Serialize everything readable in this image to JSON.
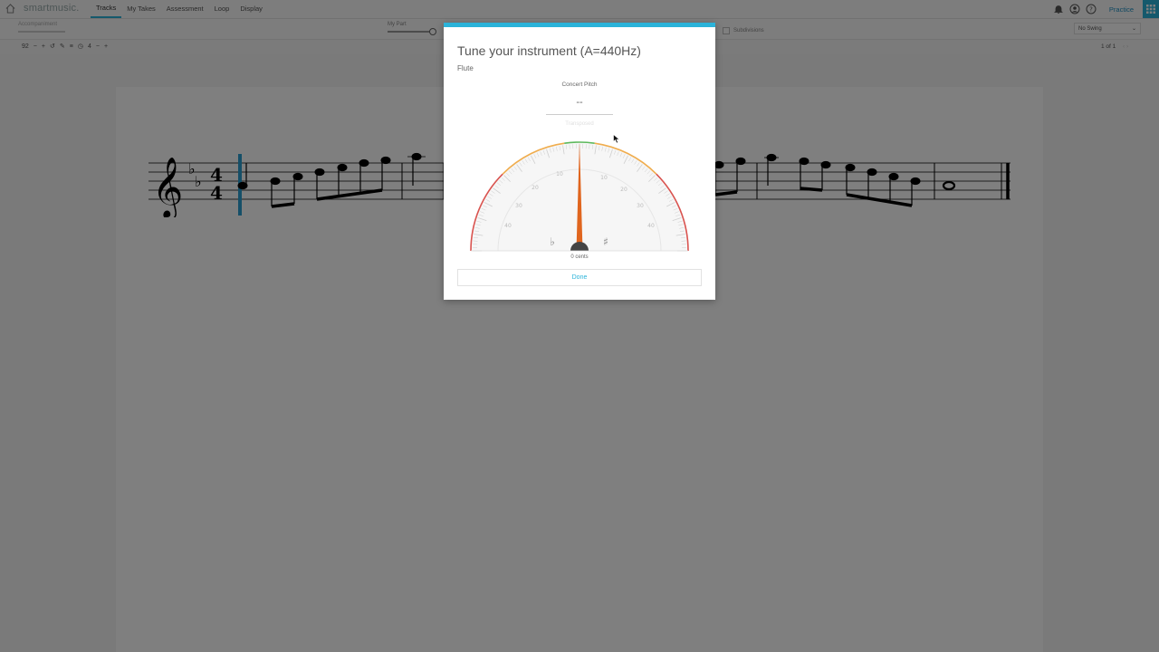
{
  "app": {
    "logo": "smartmusic."
  },
  "nav": {
    "tabs": [
      {
        "label": "Tracks",
        "active": true
      },
      {
        "label": "My Takes"
      },
      {
        "label": "Assessment"
      },
      {
        "label": "Loop"
      },
      {
        "label": "Display"
      }
    ]
  },
  "header": {
    "practice_label": "Practice"
  },
  "mixer": {
    "accompaniment_label": "Accompaniment",
    "my_part_label": "My Part"
  },
  "options": {
    "subdivisions_label": "Subdivisions",
    "swing_value": "No Swing"
  },
  "transport": {
    "tempo": "92",
    "count_in": "4",
    "page_indicator": "1 of 1"
  },
  "tuner": {
    "title": "Tune your instrument (A=440Hz)",
    "instrument": "Flute",
    "concert_pitch_label": "Concert Pitch",
    "concert_pitch_value": "--",
    "transposed_label": "Transposed",
    "cents_readout": "0 cents",
    "cents_value": 0,
    "done_label": "Done",
    "flat_symbol": "♭",
    "sharp_symbol": "♯",
    "scale_labels": {
      "left": [
        "10",
        "20",
        "30",
        "40"
      ],
      "right": [
        "10",
        "20",
        "30",
        "40"
      ]
    }
  },
  "score": {
    "clef": "treble",
    "key_signature": "B-flat major",
    "time_signature": "4/4"
  },
  "colors": {
    "accent": "#2bb3d9",
    "needle": "#e0651e",
    "in_tune": "#5cb85c",
    "near": "#f0ad4e",
    "out_of_tune": "#d9534f"
  }
}
